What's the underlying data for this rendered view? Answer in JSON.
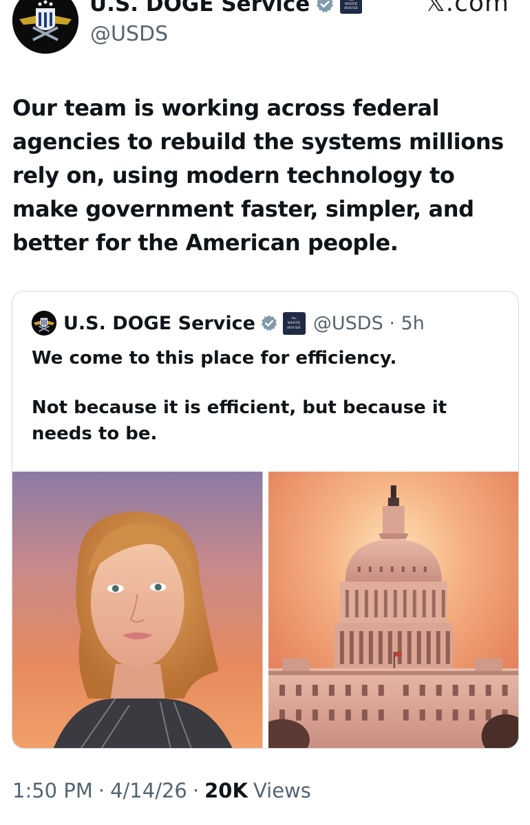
{
  "author": {
    "display_name": "U.S. DOGE Service",
    "handle": "@USDS",
    "avatar_icon": "doge-eagle-shield-logo",
    "verified_icon": "verified-gray-badge-icon",
    "affiliation_badge": "white-house-badge",
    "affiliation_text": [
      "The",
      "WHITE",
      "HOUSE"
    ]
  },
  "source": "𝕏.com",
  "tweet": {
    "text": "Our team is working across federal agencies to rebuild the systems millions rely on, using modern technology to make government faster, simpler, and better for the American people."
  },
  "quote": {
    "display_name": "U.S. DOGE Service",
    "handle_time": "@USDS · 5h",
    "paragraphs": [
      "We come to this place for efficiency.",
      "Not because it is efficient, but because it needs to be."
    ],
    "media": [
      {
        "name": "portrait-photo",
        "description": "woman-portrait-sunset"
      },
      {
        "name": "capitol-photo",
        "description": "us-capitol-sunset"
      }
    ]
  },
  "meta": {
    "time": "1:50 PM",
    "separator1": "·",
    "date": "4/14/26",
    "separator2": "·",
    "views_count": "20K",
    "views_label": "Views"
  },
  "colors": {
    "text_primary": "#0f1419",
    "text_secondary": "#536471",
    "border": "#cfd9de",
    "verified_gray": "#829aab",
    "white_house_navy": "#1f2a44"
  }
}
